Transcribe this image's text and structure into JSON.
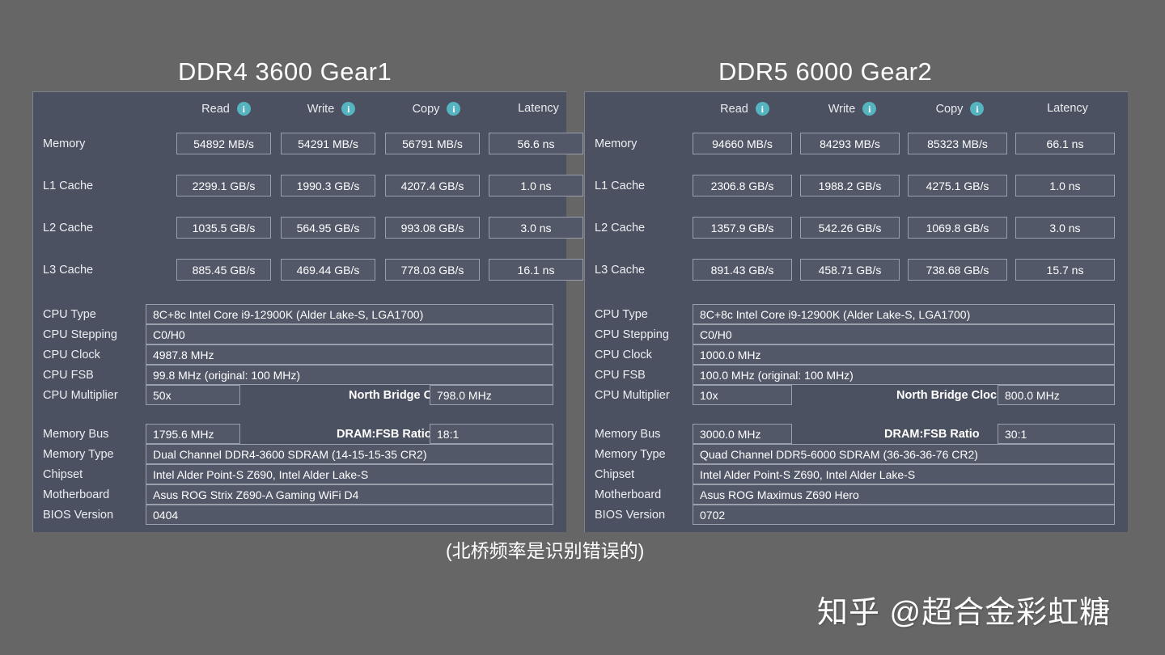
{
  "background_color": "#666666",
  "panel_color": "#4b5160",
  "accent_color": "#55b4c0",
  "caption": "(北桥频率是识别错误的)",
  "watermark": "知乎 @超合金彩虹糖",
  "panels": [
    {
      "title": "DDR4 3600  Gear1",
      "bench": {
        "columns": [
          "Read",
          "Write",
          "Copy",
          "Latency"
        ],
        "info_icon_columns": [
          "Read",
          "Write",
          "Copy"
        ],
        "info_icon_name": "info-icon",
        "rows": [
          {
            "label": "Memory",
            "values": [
              "54892 MB/s",
              "54291 MB/s",
              "56791 MB/s",
              "56.6 ns"
            ]
          },
          {
            "label": "L1 Cache",
            "values": [
              "2299.1 GB/s",
              "1990.3 GB/s",
              "4207.4 GB/s",
              "1.0 ns"
            ]
          },
          {
            "label": "L2 Cache",
            "values": [
              "1035.5 GB/s",
              "564.95 GB/s",
              "993.08 GB/s",
              "3.0 ns"
            ]
          },
          {
            "label": "L3 Cache",
            "values": [
              "885.45 GB/s",
              "469.44 GB/s",
              "778.03 GB/s",
              "16.1 ns"
            ]
          }
        ]
      },
      "cpu": {
        "type_label": "CPU Type",
        "type_value": "8C+8c Intel Core i9-12900K  (Alder Lake-S, LGA1700)",
        "stepping_label": "CPU Stepping",
        "stepping_value": "C0/H0",
        "clock_label": "CPU Clock",
        "clock_value": "4987.8 MHz",
        "fsb_label": "CPU FSB",
        "fsb_value": "99.8 MHz  (original: 100 MHz)",
        "multiplier_label": "CPU Multiplier",
        "multiplier_value": "50x",
        "nb_label": "North Bridge Clock",
        "nb_value": "798.0 MHz"
      },
      "system": {
        "membus_label": "Memory Bus",
        "membus_value": "1795.6 MHz",
        "ratio_label": "DRAM:FSB Ratio",
        "ratio_value": "18:1",
        "memtype_label": "Memory Type",
        "memtype_value": "Dual Channel DDR4-3600 SDRAM  (14-15-15-35 CR2)",
        "chipset_label": "Chipset",
        "chipset_value": "Intel Alder Point-S Z690, Intel Alder Lake-S",
        "motherboard_label": "Motherboard",
        "motherboard_value": "Asus ROG Strix Z690-A Gaming WiFi D4",
        "bios_label": "BIOS Version",
        "bios_value": "0404"
      }
    },
    {
      "title": "DDR5 6000  Gear2",
      "bench": {
        "columns": [
          "Read",
          "Write",
          "Copy",
          "Latency"
        ],
        "info_icon_columns": [
          "Read",
          "Write",
          "Copy"
        ],
        "info_icon_name": "info-icon",
        "rows": [
          {
            "label": "Memory",
            "values": [
              "94660 MB/s",
              "84293 MB/s",
              "85323 MB/s",
              "66.1 ns"
            ]
          },
          {
            "label": "L1 Cache",
            "values": [
              "2306.8 GB/s",
              "1988.2 GB/s",
              "4275.1 GB/s",
              "1.0 ns"
            ]
          },
          {
            "label": "L2 Cache",
            "values": [
              "1357.9 GB/s",
              "542.26 GB/s",
              "1069.8 GB/s",
              "3.0 ns"
            ]
          },
          {
            "label": "L3 Cache",
            "values": [
              "891.43 GB/s",
              "458.71 GB/s",
              "738.68 GB/s",
              "15.7 ns"
            ]
          }
        ]
      },
      "cpu": {
        "type_label": "CPU Type",
        "type_value": "8C+8c Intel Core i9-12900K  (Alder Lake-S, LGA1700)",
        "stepping_label": "CPU Stepping",
        "stepping_value": "C0/H0",
        "clock_label": "CPU Clock",
        "clock_value": "1000.0 MHz",
        "fsb_label": "CPU FSB",
        "fsb_value": "100.0 MHz  (original: 100 MHz)",
        "multiplier_label": "CPU Multiplier",
        "multiplier_value": "10x",
        "nb_label": "North Bridge Clock",
        "nb_value": "800.0 MHz"
      },
      "system": {
        "membus_label": "Memory Bus",
        "membus_value": "3000.0 MHz",
        "ratio_label": "DRAM:FSB Ratio",
        "ratio_value": "30:1",
        "memtype_label": "Memory Type",
        "memtype_value": "Quad Channel DDR5-6000 SDRAM  (36-36-36-76 CR2)",
        "chipset_label": "Chipset",
        "chipset_value": "Intel Alder Point-S Z690, Intel Alder Lake-S",
        "motherboard_label": "Motherboard",
        "motherboard_value": "Asus ROG Maximus Z690 Hero",
        "bios_label": "BIOS Version",
        "bios_value": "0702"
      }
    }
  ]
}
